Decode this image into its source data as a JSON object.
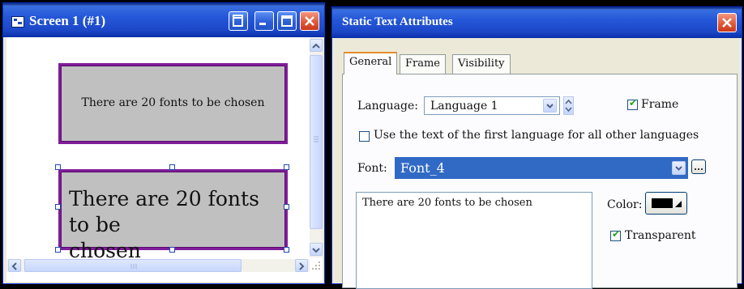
{
  "screen_window": {
    "title": "Screen 1 (#1)",
    "controls": [
      "restore",
      "minimize",
      "maximize",
      "close"
    ],
    "objects": [
      {
        "text": "There are 20 fonts to be chosen",
        "selected": false
      },
      {
        "text_line1": "There are 20 fonts to be",
        "text_line2": "chosen",
        "selected": true
      }
    ],
    "border_color": "#7f1d99",
    "object_fill": "#c0c0c0"
  },
  "dialog": {
    "title": "Static Text Attributes",
    "tabs": [
      "General",
      "Frame",
      "Visibility"
    ],
    "active_tab": "General",
    "language_label": "Language:",
    "language_value": "Language 1",
    "frame_label": "Frame",
    "frame_checked": true,
    "use_first_language_label": "Use the text of the first language for all other languages",
    "use_first_language_checked": false,
    "font_label": "Font:",
    "font_value": "Font_4",
    "text_value": "There are 20 fonts to be chosen",
    "color_label": "Color:",
    "color_value": "#000000",
    "transparent_label": "Transparent",
    "transparent_checked": true
  },
  "colors": {
    "titlebar": "#2458d8",
    "window_bg": "#ece9d8",
    "selection": "#316ac5",
    "close_button": "#e05a3a"
  }
}
